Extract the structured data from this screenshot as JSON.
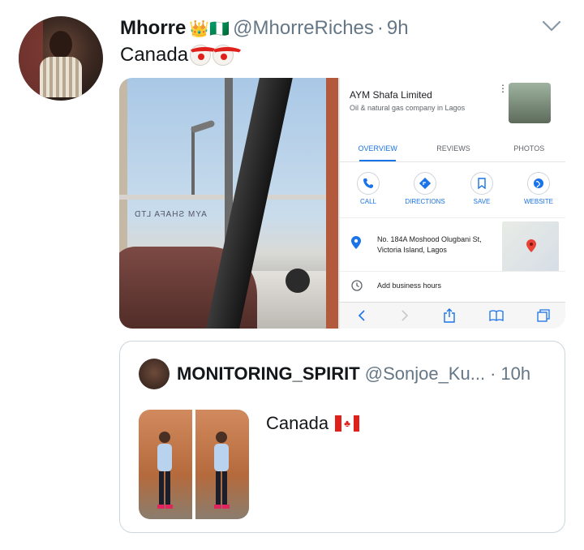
{
  "tweet": {
    "display_name": "Mhorre",
    "name_badges": "👑🇳🇬",
    "handle": "@MhorreRiches",
    "dot": "·",
    "time": "9h",
    "text": "Canada",
    "text_emoji_names": [
      "clown-face-icon",
      "clown-face-icon"
    ]
  },
  "screenshot": {
    "business_name": "AYM Shafa Limited",
    "business_subtitle": "Oil & natural gas company in Lagos",
    "more": "⋮",
    "tabs": [
      "OVERVIEW",
      "REVIEWS",
      "PHOTOS"
    ],
    "active_tab": "OVERVIEW",
    "actions": [
      "CALL",
      "DIRECTIONS",
      "SAVE",
      "WEBSITE"
    ],
    "address": "No. 184A Moshood Olugbani St, Victoria Island, Lagos",
    "hours": "Add business hours",
    "truck_text": "AYM SHAFA LTD",
    "accent_color": "#1a73e8",
    "pin_color": "#ea4335"
  },
  "quoted": {
    "display_name": "MONITORING_SPIRIT",
    "handle": "@Sonjoe_Ku...",
    "dot": "·",
    "time": "10h",
    "text": "Canada",
    "flag_icon": "canada-flag-icon"
  }
}
